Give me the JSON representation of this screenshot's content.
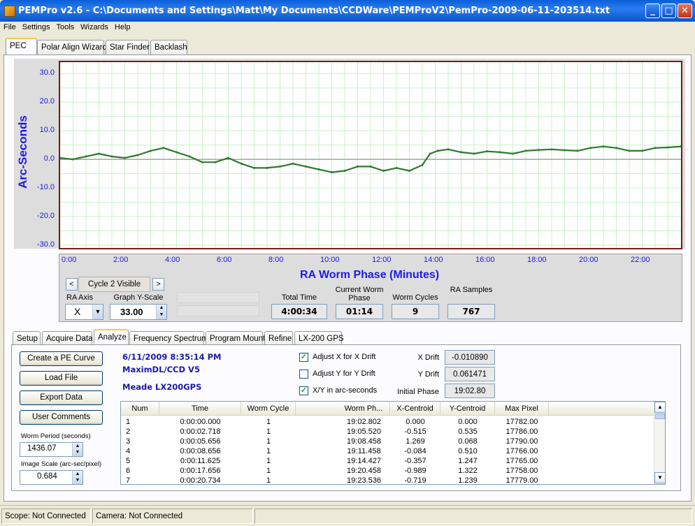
{
  "window": {
    "title": "PEMPro v2.6 - C:\\Documents and Settings\\Matt\\My Documents\\CCDWare\\PEMProV2\\PemPro-2009-06-11-203514.txt",
    "minimize": "_",
    "maximize": "□",
    "close": "✕"
  },
  "menu": [
    "File",
    "Settings",
    "Tools",
    "Wizards",
    "Help"
  ],
  "top_tabs": [
    "PEC",
    "Polar Align Wizard",
    "Star Finder",
    "Backlash"
  ],
  "chart_data": {
    "type": "line",
    "ylabel": "Arc-Seconds",
    "xlabel": "RA Worm Phase (Minutes)",
    "ylim": [
      -31,
      34
    ],
    "xlim": [
      0,
      24
    ],
    "yticks": [
      "30.0",
      "20.0",
      "10.0",
      "0.0",
      "-10.0",
      "-20.0",
      "-30.0"
    ],
    "xticks": [
      "0:00",
      "2:00",
      "4:00",
      "6:00",
      "8:00",
      "10:00",
      "12:00",
      "14:00",
      "16:00",
      "18:00",
      "20:00",
      "22:00"
    ],
    "grid": true,
    "series": [
      {
        "color": "#2d7a2d",
        "x": [
          0,
          0.5,
          1,
          1.5,
          2,
          2.5,
          3,
          3.5,
          4,
          4.5,
          5,
          5.5,
          6,
          6.5,
          7,
          7.5,
          8,
          8.5,
          9,
          9.5,
          10,
          10.5,
          11,
          11.5,
          12,
          12.5,
          13,
          13.5,
          14,
          14.3,
          14.6,
          15,
          15.5,
          16,
          16.5,
          17,
          17.5,
          18,
          18.5,
          19,
          19.5,
          20,
          20.5,
          21,
          21.5,
          22,
          22.5,
          23,
          23.5,
          24
        ],
        "y": [
          0.5,
          0,
          1,
          2,
          1,
          0.5,
          1.5,
          3,
          4,
          2.5,
          1,
          -1,
          -1,
          0.5,
          -1.5,
          -3,
          -3,
          -2.5,
          -1.5,
          -2.5,
          -3.5,
          -4.5,
          -4,
          -2.5,
          -2.5,
          -4,
          -3,
          -4,
          -2,
          2,
          3,
          3.5,
          2.5,
          2,
          2.8,
          2.5,
          2,
          3,
          3.3,
          3.5,
          3.2,
          3,
          4,
          4.5,
          4,
          3,
          3,
          4,
          4.2,
          4.5
        ]
      }
    ]
  },
  "controls": {
    "cycle_visible": "Cycle 2 Visible",
    "prev": "<",
    "next": ">",
    "ra_axis_label": "RA Axis",
    "ra_axis_value": "X",
    "graph_yscale_label": "Graph Y-Scale",
    "graph_yscale_value": "33.00",
    "total_time_label": "Total Time",
    "total_time_value": "4:00:34",
    "current_worm_phase_label": "Current Worm Phase",
    "current_worm_phase_value": "01:14",
    "worm_cycles_label": "Worm Cycles",
    "worm_cycles_value": "9",
    "ra_samples_label": "RA Samples",
    "ra_samples_value": "767"
  },
  "bottom_tabs": [
    "Setup",
    "Acquire Data",
    "Analyze",
    "Frequency Spectrum",
    "Program Mount",
    "Refine",
    "LX-200 GPS"
  ],
  "analyze": {
    "buttons": [
      "Create a PE Curve",
      "Load File",
      "Export Data",
      "User Comments"
    ],
    "worm_period_label": "Worm Period (seconds)",
    "worm_period_value": "1436.07",
    "image_scale_label": "Image Scale (arc-sec/pixel)",
    "image_scale_value": "0.684",
    "info_date": "6/11/2009 8:35:14 PM",
    "info_camera": "MaximDL/CCD V5",
    "info_mount": "Meade LX200GPS",
    "adjust_x_label": "Adjust X for X Drift",
    "adjust_x_checked": true,
    "adjust_y_label": "Adjust Y for Y Drift",
    "adjust_y_checked": false,
    "xy_arcsec_label": "X/Y in arc-seconds",
    "xy_arcsec_checked": true,
    "x_drift_label": "X Drift",
    "x_drift_value": "-0.010890",
    "y_drift_label": "Y Drift",
    "y_drift_value": "0.061471",
    "initial_phase_label": "Initial Phase",
    "initial_phase_value": "19:02.80"
  },
  "table": {
    "columns": [
      "Num",
      "Time",
      "Worm Cycle",
      "Worm Ph...",
      "X-Centroid",
      "Y-Centroid",
      "Max Pixel"
    ],
    "rows": [
      [
        "1",
        "0:00:00.000",
        "1",
        "19:02.802",
        "0.000",
        "0.000",
        "17782.00"
      ],
      [
        "2",
        "0:00:02.718",
        "1",
        "19:05.520",
        "-0.515",
        "0.535",
        "17786.00"
      ],
      [
        "3",
        "0:00:05.656",
        "1",
        "19:08.458",
        "1.269",
        "0.068",
        "17790.00"
      ],
      [
        "4",
        "0:00:08.656",
        "1",
        "19:11.458",
        "-0.084",
        "0.510",
        "17766.00"
      ],
      [
        "5",
        "0:00:11.625",
        "1",
        "19:14.427",
        "-0.357",
        "1.247",
        "17765.00"
      ],
      [
        "6",
        "0:00:17.656",
        "1",
        "19:20.458",
        "-0.989",
        "1.322",
        "17758.00"
      ],
      [
        "7",
        "0:00:20.734",
        "1",
        "19:23.536",
        "-0.719",
        "1.239",
        "17779.00"
      ]
    ]
  },
  "status": {
    "scope": "Scope: Not Connected",
    "camera": "Camera: Not Connected"
  }
}
